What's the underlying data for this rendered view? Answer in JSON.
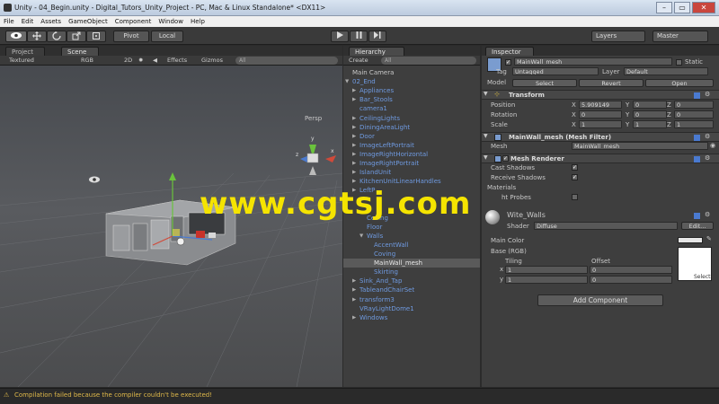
{
  "window": {
    "title": "Unity - 04_Begin.unity - Digital_Tutors_Unity_Project - PC, Mac & Linux Standalone* <DX11>",
    "buttons": [
      "–",
      "▭",
      "✕"
    ]
  },
  "menu": [
    "File",
    "Edit",
    "Assets",
    "GameObject",
    "Component",
    "Window",
    "Help"
  ],
  "toolbar": {
    "pivot": "Pivot",
    "local": "Local",
    "layers": "Layers",
    "layout": "Master"
  },
  "scene_panel": {
    "tabs": [
      "Project",
      "Scene"
    ],
    "shading": "Textured",
    "render": "RGB",
    "mode_2d": "2D",
    "effects": "Effects",
    "gizmos": "Gizmos",
    "search": "All",
    "persp": "Persp",
    "gizmo_axes": {
      "x": "x",
      "y": "y",
      "z": "z"
    }
  },
  "hierarchy": {
    "tab": "Hierarchy",
    "create": "Create",
    "search": "All",
    "items": [
      {
        "label": "Main Camera",
        "indent": 0,
        "arrow": "",
        "style": "plain"
      },
      {
        "label": "02_End",
        "indent": 0,
        "arrow": "▼",
        "style": "prefab"
      },
      {
        "label": "Appliances",
        "indent": 1,
        "arrow": "▶",
        "style": "prefab"
      },
      {
        "label": "Bar_Stools",
        "indent": 1,
        "arrow": "▶",
        "style": "prefab"
      },
      {
        "label": "camera1",
        "indent": 1,
        "arrow": "",
        "style": "prefab"
      },
      {
        "label": "CeilingLights",
        "indent": 1,
        "arrow": "▶",
        "style": "prefab"
      },
      {
        "label": "DiningAreaLight",
        "indent": 1,
        "arrow": "▶",
        "style": "prefab"
      },
      {
        "label": "Door",
        "indent": 1,
        "arrow": "▶",
        "style": "prefab"
      },
      {
        "label": "ImageLeftPortrait",
        "indent": 1,
        "arrow": "▶",
        "style": "prefab"
      },
      {
        "label": "ImageRightHorizontal",
        "indent": 1,
        "arrow": "▶",
        "style": "prefab"
      },
      {
        "label": "ImageRightPortrait",
        "indent": 1,
        "arrow": "▶",
        "style": "prefab"
      },
      {
        "label": "IslandUnit",
        "indent": 1,
        "arrow": "▶",
        "style": "prefab"
      },
      {
        "label": "KitchenUnitLinearHandles",
        "indent": 1,
        "arrow": "▶",
        "style": "prefab"
      },
      {
        "label": "LeftP",
        "indent": 1,
        "arrow": "▶",
        "style": "prefab"
      },
      {
        "label": "",
        "indent": 1,
        "arrow": "",
        "style": "prefab"
      },
      {
        "label": "",
        "indent": 1,
        "arrow": "",
        "style": "prefab"
      },
      {
        "label": "Ceiling",
        "indent": 2,
        "arrow": "",
        "style": "prefab"
      },
      {
        "label": "Floor",
        "indent": 2,
        "arrow": "",
        "style": "prefab"
      },
      {
        "label": "Walls",
        "indent": 2,
        "arrow": "▼",
        "style": "prefab"
      },
      {
        "label": "AccentWall",
        "indent": 3,
        "arrow": "",
        "style": "prefab"
      },
      {
        "label": "Coving",
        "indent": 3,
        "arrow": "",
        "style": "prefab"
      },
      {
        "label": "MainWall_mesh",
        "indent": 3,
        "arrow": "",
        "style": "sel"
      },
      {
        "label": "Skirting",
        "indent": 3,
        "arrow": "",
        "style": "prefab"
      },
      {
        "label": "Sink_And_Tap",
        "indent": 1,
        "arrow": "▶",
        "style": "prefab"
      },
      {
        "label": "TableandChairSet",
        "indent": 1,
        "arrow": "▶",
        "style": "prefab"
      },
      {
        "label": "transform3",
        "indent": 1,
        "arrow": "▶",
        "style": "prefab"
      },
      {
        "label": "VRayLightDome1",
        "indent": 1,
        "arrow": "",
        "style": "prefab"
      },
      {
        "label": "Windows",
        "indent": 1,
        "arrow": "▶",
        "style": "prefab"
      }
    ]
  },
  "inspector": {
    "tab": "Inspector",
    "object_name": "MainWall_mesh",
    "static": "Static",
    "tag_label": "Tag",
    "tag_value": "Untagged",
    "layer_label": "Layer",
    "layer_value": "Default",
    "model_label": "Model",
    "model_select": "Select",
    "model_revert": "Revert",
    "model_open": "Open",
    "transform": {
      "title": "Transform",
      "position_label": "Position",
      "rotation_label": "Rotation",
      "scale_label": "Scale",
      "position": {
        "x": "5.909149",
        "y": "0",
        "z": "0"
      },
      "rotation": {
        "x": "0",
        "y": "0",
        "z": "0"
      },
      "scale": {
        "x": "1",
        "y": "1",
        "z": "1"
      },
      "axis": {
        "x": "X",
        "y": "Y",
        "z": "Z"
      }
    },
    "mesh_filter": {
      "title": "MainWall_mesh (Mesh Filter)",
      "mesh_label": "Mesh",
      "mesh_value": "MainWall_mesh"
    },
    "mesh_renderer": {
      "title": "Mesh Renderer",
      "cast_shadows": "Cast Shadows",
      "receive_shadows": "Receive Shadows",
      "materials": "Materials",
      "light_probes": "ht Probes"
    },
    "material": {
      "name": "Wite_Walls",
      "shader_label": "Shader",
      "shader_value": "Diffuse",
      "edit": "Edit...",
      "main_color": "Main Color",
      "base": "Base (RGB)",
      "tiling": "Tiling",
      "offset": "Offset",
      "x_label": "x",
      "y_label": "y",
      "tiling_x": "1",
      "tiling_y": "1",
      "offset_x": "0",
      "offset_y": "0",
      "select": "Select"
    },
    "add_component": "Add Component"
  },
  "status": "Compilation failed because the compiler couldn't be executed!",
  "watermark": "www.cgtsj.com",
  "colors": {
    "accent_blue": "#6f9ae0",
    "warning": "#e0b94a",
    "gizmo_y": "#6ac33c",
    "gizmo_x": "#d04a3a",
    "gizmo_z": "#4a7ad0"
  }
}
